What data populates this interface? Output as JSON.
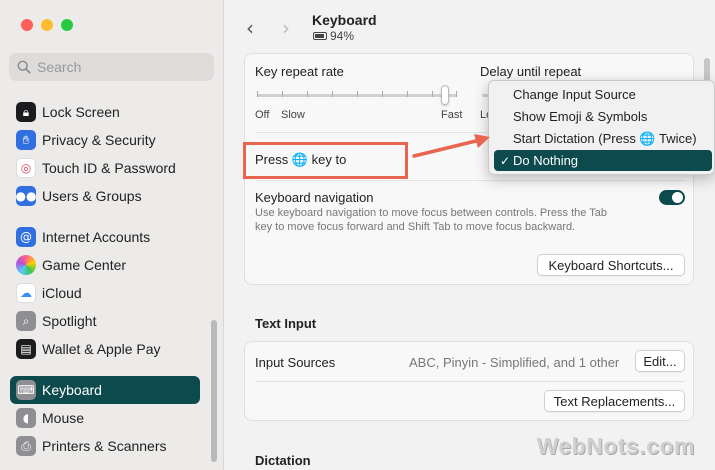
{
  "sidebar": {
    "search_placeholder": "Search",
    "items": [
      {
        "label": "Lock Screen",
        "icon": "lock-icon",
        "color": "#1c1c1e",
        "glyph": "▪"
      },
      {
        "label": "Privacy & Security",
        "icon": "hand-icon",
        "color": "#2f6fe0",
        "glyph": "✋"
      },
      {
        "label": "Touch ID & Password",
        "icon": "fingerprint-icon",
        "color": "#f2f2f2",
        "glyph": "◉"
      },
      {
        "label": "Users & Groups",
        "icon": "users-icon",
        "color": "#2f6fe0",
        "glyph": "👥"
      },
      {
        "label": "Internet Accounts",
        "icon": "at-icon",
        "color": "#2f6fe0",
        "glyph": "@"
      },
      {
        "label": "Game Center",
        "icon": "game-center-icon",
        "color": "#ffffff",
        "glyph": "●"
      },
      {
        "label": "iCloud",
        "icon": "cloud-icon",
        "color": "#ffffff",
        "glyph": "☁"
      },
      {
        "label": "Spotlight",
        "icon": "magnifier-icon",
        "color": "#8e8e93",
        "glyph": "⌕"
      },
      {
        "label": "Wallet & Apple Pay",
        "icon": "wallet-icon",
        "color": "#1c1c1e",
        "glyph": "▤"
      },
      {
        "label": "Keyboard",
        "icon": "keyboard-icon",
        "color": "#8e8e93",
        "glyph": "⌨"
      },
      {
        "label": "Mouse",
        "icon": "mouse-icon",
        "color": "#8e8e93",
        "glyph": "◖"
      },
      {
        "label": "Printers & Scanners",
        "icon": "printer-icon",
        "color": "#8e8e93",
        "glyph": "⎙"
      }
    ],
    "selected": "Keyboard"
  },
  "header": {
    "title": "Keyboard",
    "battery": "94%",
    "battery_level": 0.94
  },
  "keyboard": {
    "key_repeat_label": "Key repeat rate",
    "key_repeat_off": "Off",
    "key_repeat_slow": "Slow",
    "key_repeat_fast": "Fast",
    "key_repeat_value": 0.94,
    "delay_label": "Delay until repeat",
    "delay_left": "Lo",
    "press_key_prefix": "Press",
    "press_key_globe": "🌐",
    "press_key_suffix": "key to",
    "keyboard_nav_label": "Keyboard navigation",
    "keyboard_nav_desc_1": "Use keyboard navigation to move focus between controls. Press the Tab",
    "keyboard_nav_desc_2": "key to move focus forward and Shift Tab to move focus backward.",
    "keyboard_nav_on": true,
    "shortcuts_button": "Keyboard Shortcuts..."
  },
  "text_input": {
    "section": "Text Input",
    "input_sources_label": "Input Sources",
    "input_sources_value": "ABC, Pinyin - Simplified, and 1 other",
    "edit_button": "Edit...",
    "text_replacements_button": "Text Replacements..."
  },
  "dictation": {
    "section": "Dictation"
  },
  "popup_menu": {
    "items": [
      {
        "label": "Change Input Source",
        "selected": false
      },
      {
        "label": "Show Emoji & Symbols",
        "selected": false
      },
      {
        "label": "Start Dictation (Press 🌐 Twice)",
        "selected": false
      },
      {
        "label": "Do Nothing",
        "selected": true
      }
    ]
  },
  "watermark": "WebNots.com",
  "colors": {
    "accent": "#0c4a4d",
    "annotation": "#e8664f"
  }
}
